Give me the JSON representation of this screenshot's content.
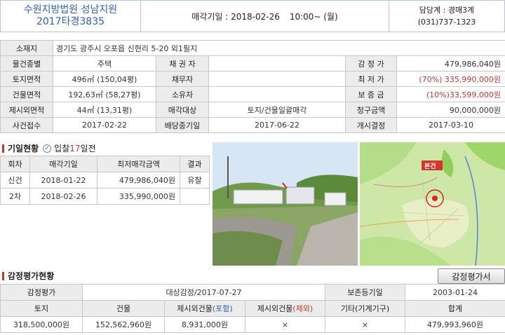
{
  "header": {
    "court": "수원지방법원 성남지원",
    "case_no": "2017타경3835",
    "sale_date_label": "매각기일 : 2018-02-26",
    "sale_time": "10:00~ (월)",
    "dept": "담당계 : 경매3계",
    "phone": "(031)737-1323"
  },
  "info": {
    "addr_label": "소재지",
    "addr_value": "경기도 광주시 오포읍 신현리 5-20 외1필지",
    "rows": [
      {
        "l1": "물건종별",
        "v1": "주택",
        "l2": "채 권 자",
        "v2": "",
        "l3": "감 정 가",
        "v3": "479,986,040원"
      },
      {
        "l1": "토지면적",
        "v1": "496㎡ (150,04평)",
        "l2": "채무자",
        "v2": "",
        "l3": "최 저 가",
        "v3_red": "(70%)",
        "v3": "335,990,000원"
      },
      {
        "l1": "건물면적",
        "v1": "192,63㎡ (58,27평)",
        "l2": "소유자",
        "v2": "",
        "l3": "보 증 금",
        "v3_red": "(10%)",
        "v3": "33,599,000원"
      },
      {
        "l1": "제시외면적",
        "v1": "44㎡ (13,31평)",
        "l2": "매각대상",
        "v2": "토지/건물일괄매각",
        "l3": "청구금액",
        "v3": "90,000,000원"
      },
      {
        "l1": "사건접수",
        "v1": "2017-02-22",
        "l2": "배당종기일",
        "v2": "2017-06-22",
        "l3": "개시결정",
        "v3": "2017-03-10"
      }
    ]
  },
  "history": {
    "title": "기일현황",
    "sub_prefix": "입찰",
    "sub_days": "17",
    "sub_suffix": "일전",
    "headers": [
      "회차",
      "매각기일",
      "최저매각금액",
      "결과"
    ],
    "rows": [
      {
        "round": "신건",
        "date": "2018-01-22",
        "price": "479,986,040원",
        "result": "유찰"
      },
      {
        "round": "2차",
        "date": "2018-02-26",
        "price": "335,990,000원",
        "result": ""
      }
    ]
  },
  "map": {
    "marker_label": "본건"
  },
  "appraisal": {
    "title": "감정평가현황",
    "button": "감정평가서",
    "r1": {
      "c1": "감정평가",
      "c2": "대상감정/2017-07-27",
      "c3": "보존등기일",
      "c4": "2003-01-24"
    },
    "headers": [
      "토지",
      "건물",
      "제시외건물",
      "(포함)",
      "제시외건물",
      "(제외)",
      "기타(기계기구)",
      "합계"
    ],
    "values": [
      "318,500,000원",
      "152,562,960원",
      "8,931,000원",
      "×",
      "×",
      "479,993,960원"
    ]
  },
  "colors": {
    "accent_blue": "#2f62b5",
    "accent_red": "#c0392b"
  }
}
